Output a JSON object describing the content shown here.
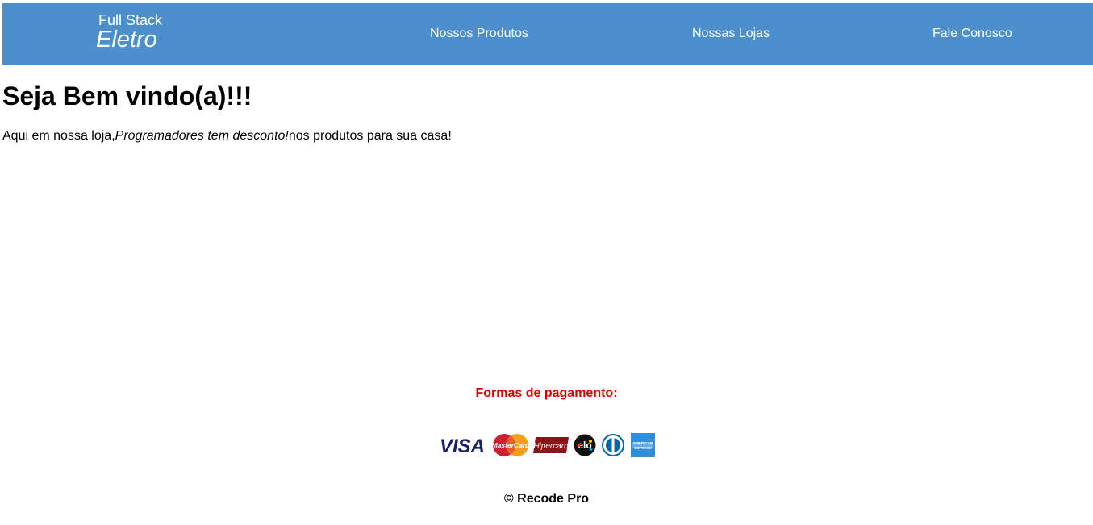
{
  "header": {
    "logo_line1": "Full Stack",
    "logo_line2": "Eletro",
    "nav": [
      {
        "label": "Nossos Produtos"
      },
      {
        "label": "Nossas Lojas"
      },
      {
        "label": "Fale Conosco"
      }
    ],
    "background_color": "#4d8fcc"
  },
  "main": {
    "title": "Seja Bem vindo(a)!!!",
    "text_before": "Aqui em nossa loja,",
    "text_emphasis": "Programadores tem desconto!",
    "text_after": "nos produtos para sua casa!"
  },
  "footer": {
    "payment_title": "Formas de pagamento:",
    "payment_title_color": "#e00000",
    "payment_methods": [
      {
        "name": "VISA",
        "icon": "visa-icon"
      },
      {
        "name": "MasterCard",
        "icon": "mastercard-icon"
      },
      {
        "name": "Hipercard",
        "icon": "hipercard-icon"
      },
      {
        "name": "elo",
        "icon": "elo-icon"
      },
      {
        "name": "Diners Club",
        "icon": "diners-icon"
      },
      {
        "name": "American Express",
        "icon": "amex-icon"
      }
    ],
    "copyright": "© Recode Pro"
  }
}
